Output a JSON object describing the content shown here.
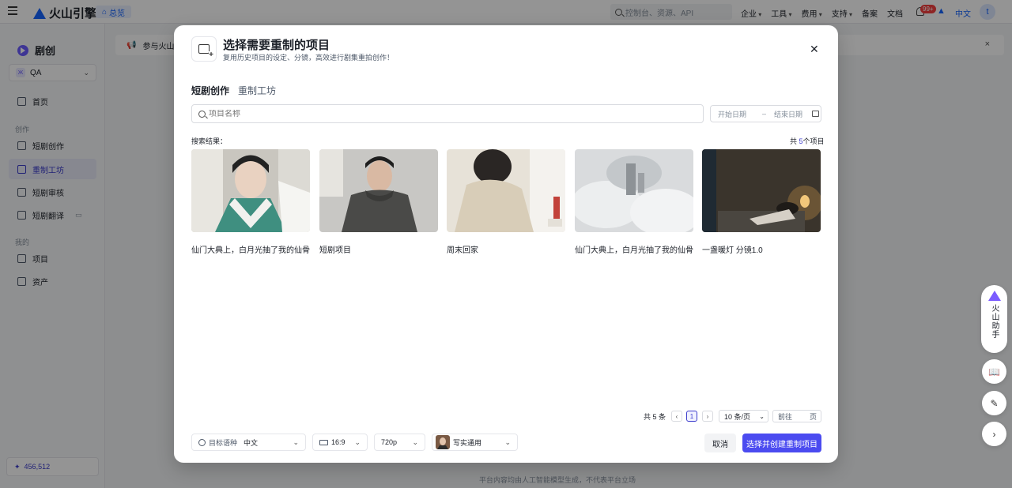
{
  "topnav": {
    "brand": "火山引擎",
    "overview": "总览",
    "search_placeholder": "控制台、资源、API",
    "links": [
      "企业",
      "工具",
      "费用",
      "支持",
      "备案",
      "文档"
    ],
    "notification_badge": "99+",
    "language": "中文",
    "avatar_initial": "t"
  },
  "sidebar": {
    "brand": "剧创",
    "workspace": "QA",
    "workspace_badge": "Ж",
    "home": "首页",
    "section_create": "创作",
    "items_create": [
      "短剧创作",
      "重制工坊",
      "短剧审核",
      "短剧翻译"
    ],
    "section_mine": "我的",
    "items_mine": [
      "项目",
      "资产"
    ],
    "credits": "456,512"
  },
  "main": {
    "banner": "参与火山",
    "footer": "平台内容均由人工智能模型生成，不代表平台立场"
  },
  "assistant": {
    "label": "火山助手"
  },
  "modal": {
    "title": "选择需要重制的项目",
    "subtitle": "复用历史项目的设定、分镜，高效进行剧集重拍创作！",
    "tabs": [
      "短剧创作",
      "重制工坊"
    ],
    "search_placeholder": "项目名称",
    "date_start": "开始日期",
    "date_sep": "–",
    "date_end": "结束日期",
    "results_label": "搜索结果：",
    "results_count_prefix": "共 ",
    "results_count_num": "5",
    "results_count_suffix": "个项目",
    "projects": [
      {
        "name": "仙门大典上，白月光抽了我的仙骨"
      },
      {
        "name": "短剧项目"
      },
      {
        "name": "周末回家"
      },
      {
        "name": "仙门大典上，白月光抽了我的仙骨"
      },
      {
        "name": "一盏暖灯 分镜1.0"
      }
    ],
    "pagination": {
      "total": "共 5 条",
      "prev": "‹",
      "current": "1",
      "next": "›",
      "page_size": "10 条/页",
      "goto": "前往",
      "goto_unit": "页"
    },
    "footer": {
      "target_lang_label": "目标语种",
      "target_lang": "中文",
      "ratio": "16:9",
      "resolution": "720p",
      "style": "写实通用",
      "cancel": "取消",
      "confirm": "选择并创建重制项目"
    }
  }
}
